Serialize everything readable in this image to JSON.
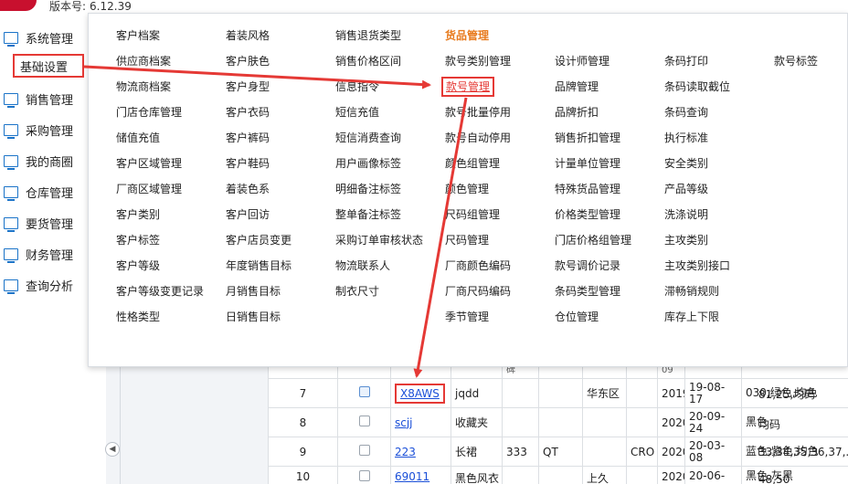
{
  "header": {
    "version_label": "版本号:",
    "version": "6.12.39"
  },
  "sidebar": {
    "items": [
      {
        "label": "系统管理",
        "icon": "monitor-icon"
      },
      {
        "label": "基础设置",
        "icon": "monitor-icon",
        "highlighted": true
      },
      {
        "label": "销售管理",
        "icon": "monitor-icon"
      },
      {
        "label": "采购管理",
        "icon": "monitor-icon"
      },
      {
        "label": "我的商圈",
        "icon": "monitor-icon"
      },
      {
        "label": "仓库管理",
        "icon": "monitor-icon"
      },
      {
        "label": "要货管理",
        "icon": "monitor-icon"
      },
      {
        "label": "财务管理",
        "icon": "monitor-icon"
      },
      {
        "label": "查询分析",
        "icon": "monitor-icon"
      }
    ]
  },
  "menu": {
    "columns": [
      [
        "客户档案",
        "供应商档案",
        "物流商档案",
        "门店仓库管理",
        "储值充值",
        "客户区域管理",
        "厂商区域管理",
        "客户类别",
        "客户标签",
        "客户等级",
        "客户等级变更记录",
        "性格类型"
      ],
      [
        "着装风格",
        "客户肤色",
        "客户身型",
        "客户衣码",
        "客户裤码",
        "客户鞋码",
        "着装色系",
        "客户回访",
        "客户店员变更",
        "年度销售目标",
        "月销售目标",
        "日销售目标"
      ],
      [
        "销售退货类型",
        "销售价格区间",
        "信息指令",
        "短信充值",
        "短信消费查询",
        "用户画像标签",
        "明细备注标签",
        "整单备注标签",
        "采购订单审核状态",
        "物流联系人",
        "制衣尺寸"
      ],
      [
        "货品管理",
        "款号类别管理",
        "款号管理",
        "款号批量停用",
        "款号自动停用",
        "颜色组管理",
        "颜色管理",
        "尺码组管理",
        "尺码管理",
        "厂商颜色编码",
        "厂商尺码编码",
        "季节管理"
      ],
      [
        "",
        "设计师管理",
        "品牌管理",
        "品牌折扣",
        "销售折扣管理",
        "计量单位管理",
        "特殊货品管理",
        "价格类型管理",
        "门店价格组管理",
        "款号调价记录",
        "条码类型管理",
        "仓位管理"
      ],
      [
        "",
        "条码打印",
        "条码读取截位",
        "条码查询",
        "执行标准",
        "安全类别",
        "产品等级",
        "洗涤说明",
        "主攻类别",
        "主攻类别接口",
        "滞畅销规则",
        "库存上下限"
      ],
      [
        "",
        "款号标签"
      ]
    ],
    "highlighted_item": "款号管理"
  },
  "table": {
    "partial_top": [
      "",
      "",
      "",
      "",
      "碑",
      "",
      "",
      "",
      "09",
      "",
      ""
    ],
    "rows": [
      {
        "no": "7",
        "code": "X8AWS",
        "name": "jqdd",
        "c4": "",
        "c5": "",
        "c6": "华东区",
        "c7": "",
        "year": "2019",
        "date": "19-08-17",
        "colors": "030,绿色,均色",
        "sizes": "81,25,均码",
        "highlight": true
      },
      {
        "no": "8",
        "code": "scjj",
        "name": "收藏夹",
        "c4": "",
        "c5": "",
        "c6": "",
        "c7": "",
        "year": "2020",
        "date": "20-09-24",
        "colors": "黑色",
        "sizes": "均码",
        "highlight": false
      },
      {
        "no": "9",
        "code": "223",
        "name": "长裙",
        "c4": "333",
        "c5": "QT",
        "c6": "",
        "c7": "CRO",
        "year": "2020",
        "date": "20-03-08",
        "colors": "蓝色,紫色,均色",
        "sizes": "33,34,35,36,37,..",
        "highlight": false
      },
      {
        "no": "10",
        "code": "69011",
        "name": "黑色风衣",
        "c4": "",
        "c5": "",
        "c6": "上久",
        "c7": "",
        "year": "2020",
        "date": "20-06-",
        "colors": "黑色,灰黑",
        "sizes": "48,50",
        "highlight": false
      }
    ]
  },
  "ui": {
    "collapse_icon": "chevron-left-icon",
    "accent": "#e53935",
    "link": "#1a4fd8",
    "menu_head": "#e87b1e"
  }
}
